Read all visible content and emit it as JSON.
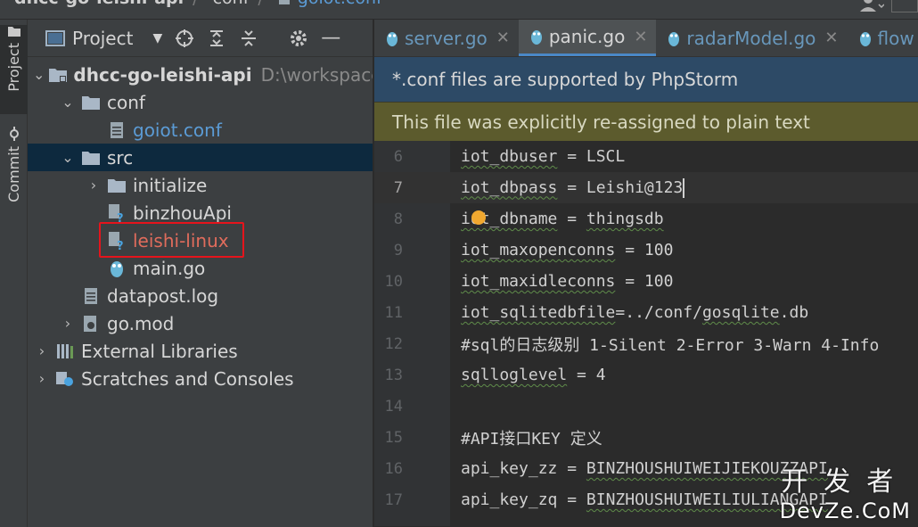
{
  "breadcrumb": {
    "project": "dhcc-go-leishi-api",
    "folder": "conf",
    "file": "goiot.conf"
  },
  "toolwindows": {
    "project_tab": "Project",
    "commit_tab": "Commit"
  },
  "panel": {
    "title": "Project"
  },
  "tree": [
    {
      "label": "dhcc-go-leishi-api",
      "path": "D:\\workspace",
      "kind": "module"
    },
    {
      "label": "conf",
      "kind": "folder"
    },
    {
      "label": "goiot.conf",
      "kind": "conf-file"
    },
    {
      "label": "src",
      "kind": "folder"
    },
    {
      "label": "initialize",
      "kind": "folder"
    },
    {
      "label": "binzhouApi",
      "kind": "unknown-file"
    },
    {
      "label": "leishi-linux",
      "kind": "unknown-file"
    },
    {
      "label": "main.go",
      "kind": "go-file"
    },
    {
      "label": "datapost.log",
      "kind": "log-file"
    },
    {
      "label": "go.mod",
      "kind": "mod-file"
    },
    {
      "label": "External Libraries",
      "kind": "library"
    },
    {
      "label": "Scratches and Consoles",
      "kind": "scratch"
    }
  ],
  "tabs": [
    {
      "label": "server.go",
      "active": false
    },
    {
      "label": "panic.go",
      "active": true
    },
    {
      "label": "radarModel.go",
      "active": false
    },
    {
      "label": "flow",
      "active": false
    }
  ],
  "banners": {
    "plugin": "*.conf files are supported by PhpStorm",
    "reassigned": "This file was explicitly re-assigned to plain text"
  },
  "code_lines": [
    {
      "n": "6",
      "text": "iot_dbuser = LSCL"
    },
    {
      "n": "7",
      "text": "iot_dbpass = Leishi@123"
    },
    {
      "n": "8",
      "text": "iot_dbname = thingsdb"
    },
    {
      "n": "9",
      "text": "iot_maxopenconns = 100"
    },
    {
      "n": "10",
      "text": "iot_maxidleconns = 100"
    },
    {
      "n": "11",
      "text": "iot_sqlitedbfile=../conf/gosqlite.db"
    },
    {
      "n": "12",
      "text": "#sql的日志级别 1-Silent 2-Error 3-Warn 4-Info"
    },
    {
      "n": "13",
      "text": "sqlloglevel = 4"
    },
    {
      "n": "14",
      "text": ""
    },
    {
      "n": "15",
      "text": "#API接口KEY 定义"
    },
    {
      "n": "16",
      "text": "api_key_zz = BINZHOUSHUIWEIJIEKOUZZAPI"
    },
    {
      "n": "17",
      "text": "api_key_zq = BINZHOUSHUIWEILIULIANGAPI"
    }
  ],
  "watermark": {
    "cn": "开发者",
    "en": "DevZe.CoM"
  },
  "colors": {
    "accent": "#4a88c7",
    "highlight_border": "#e5141c",
    "plugin_banner": "#2d4a66",
    "reassign_banner": "#5c5b2d"
  }
}
